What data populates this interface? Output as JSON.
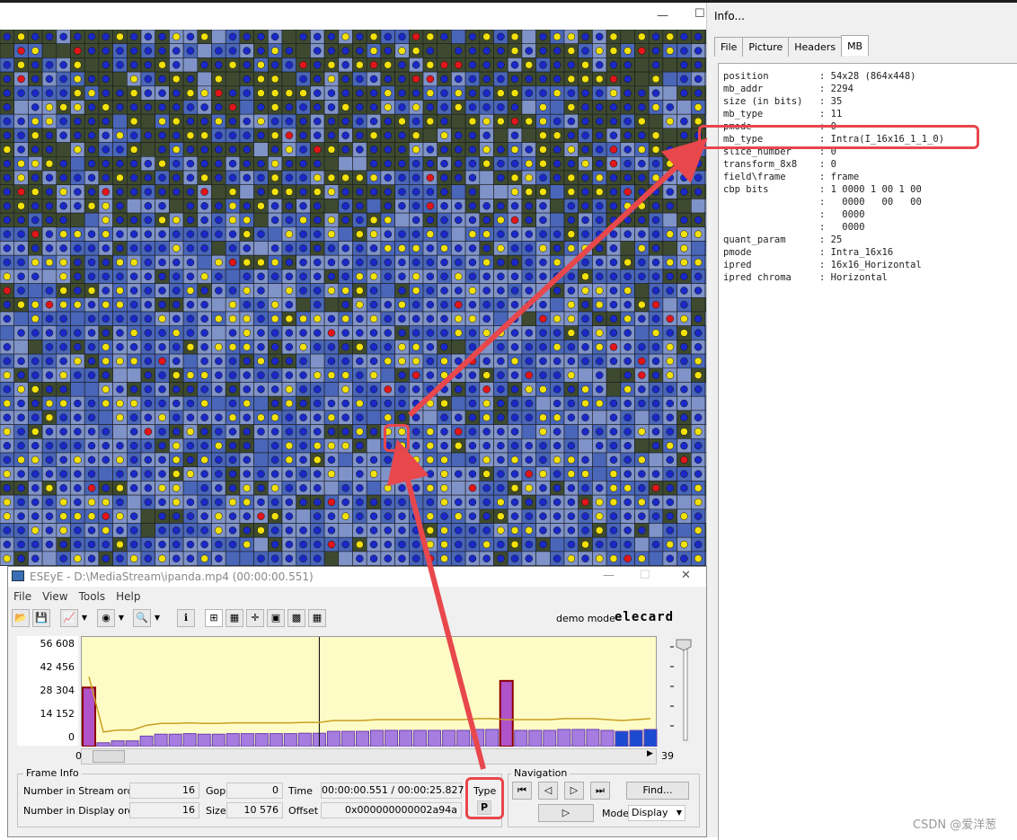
{
  "info_window": {
    "title": "Info...",
    "tabs": [
      "File",
      "Picture",
      "Headers",
      "MB"
    ],
    "active_tab": "MB",
    "fields": [
      {
        "key": "position",
        "value": "54x28 (864x448)"
      },
      {
        "key": "mb_addr",
        "value": "2294"
      },
      {
        "key": "size (in bits)",
        "value": "35"
      },
      {
        "key": "mb_type",
        "value": "11"
      },
      {
        "key": "pmode",
        "value": "0"
      },
      {
        "key": "mb_type",
        "value": "Intra(I_16x16_1_1_0)"
      },
      {
        "key": "slice_number",
        "value": "0"
      },
      {
        "key": "transform_8x8",
        "value": "0"
      },
      {
        "key": "field\\frame",
        "value": "frame"
      },
      {
        "key": "cbp bits",
        "value": "1 0000 1 00 1 00"
      },
      {
        "key": "",
        "value": "  0000   00   00"
      },
      {
        "key": "",
        "value": "  0000"
      },
      {
        "key": "",
        "value": "  0000"
      },
      {
        "key": "quant_param",
        "value": "25"
      },
      {
        "key": "pmode",
        "value": "Intra_16x16"
      },
      {
        "key": "ipred",
        "value": "16x16_Horizontal"
      },
      {
        "key": "ipred chroma",
        "value": "Horizontal"
      }
    ]
  },
  "esye_window": {
    "title": "ESEyE - D:\\MediaStream\\ipanda.mp4 (00:00:00.551)",
    "menu": [
      "File",
      "View",
      "Tools",
      "Help"
    ],
    "demo_mode": "demo mode",
    "brand": "elecard",
    "y_axis_labels": [
      "56 608",
      "42 456",
      "28 304",
      "14 152",
      "0"
    ],
    "scroll_left": "0",
    "scroll_right": "39",
    "frame_info": {
      "legend": "Frame Info",
      "number_in_stream_order_label": "Number in Stream order",
      "number_in_stream_order": "16",
      "number_in_display_order_label": "Number in Display order",
      "number_in_display_order": "16",
      "gop_label": "Gop",
      "gop": "0",
      "size_label": "Size",
      "size": "10 576",
      "time_label": "Time",
      "time": "00:00:00.551 / 00:00:25.827",
      "offset_label": "Offset",
      "offset": "0x000000000002a94a",
      "type_label": "Type",
      "type": "P"
    },
    "navigation": {
      "legend": "Navigation",
      "find_label": "Find...",
      "mode_label": "Mode",
      "mode_value": "Display"
    }
  },
  "chart_data": {
    "type": "bar",
    "ylim": [
      0,
      56608
    ],
    "y_ticks": [
      0,
      14152,
      28304,
      42456,
      56608
    ],
    "values": [
      31000,
      2000,
      3000,
      3000,
      5500,
      6500,
      6500,
      6800,
      6500,
      6500,
      6800,
      6800,
      6800,
      6800,
      6800,
      7000,
      7000,
      8000,
      8000,
      8000,
      8500,
      8500,
      8500,
      8500,
      8500,
      8500,
      8500,
      9000,
      9000,
      8500,
      8500,
      8500,
      8500,
      9000,
      9000,
      9000,
      8500,
      8000,
      8500,
      9000
    ],
    "highlight_index": 29,
    "highlight_value": 34500,
    "current_index": 16
  },
  "watermark": "CSDN @爱洋葱"
}
